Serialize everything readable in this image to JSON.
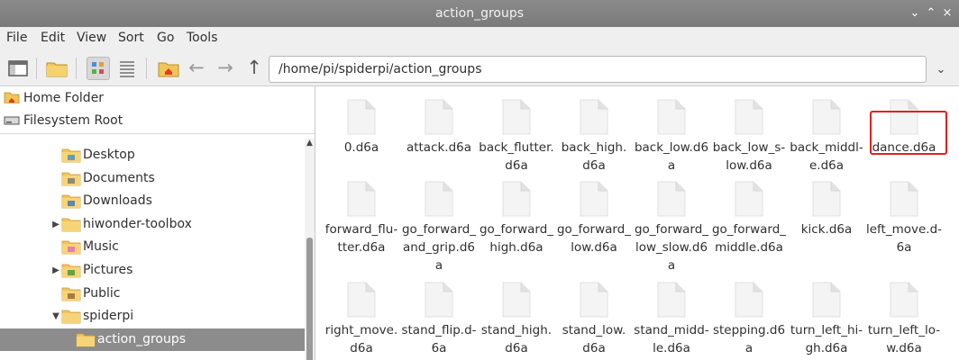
{
  "window": {
    "title": "action_groups",
    "minimize": "⌄",
    "maximize": "⌃",
    "close": "×"
  },
  "menu": [
    "File",
    "Edit",
    "View",
    "Sort",
    "Go",
    "Tools"
  ],
  "toolbar": {
    "path": "/home/pi/spiderpi/action_groups",
    "back": "←",
    "forward": "→",
    "up": "↑",
    "path_dropdown": "⌄"
  },
  "places": [
    {
      "label": "Home Folder",
      "icon": "home-folder-icon"
    },
    {
      "label": "Filesystem Root",
      "icon": "drive-icon"
    }
  ],
  "tree": [
    {
      "label": "Desktop",
      "icon": "desktop-folder-icon",
      "indent": 2,
      "expander": ""
    },
    {
      "label": "Documents",
      "icon": "documents-folder-icon",
      "indent": 2,
      "expander": ""
    },
    {
      "label": "Downloads",
      "icon": "downloads-folder-icon",
      "indent": 2,
      "expander": ""
    },
    {
      "label": "hiwonder-toolbox",
      "icon": "folder-icon",
      "indent": 2,
      "expander": "▶"
    },
    {
      "label": "Music",
      "icon": "music-folder-icon",
      "indent": 2,
      "expander": ""
    },
    {
      "label": "Pictures",
      "icon": "pictures-folder-icon",
      "indent": 2,
      "expander": "▶"
    },
    {
      "label": "Public",
      "icon": "public-folder-icon",
      "indent": 2,
      "expander": ""
    },
    {
      "label": "spiderpi",
      "icon": "folder-icon",
      "indent": 2,
      "expander": "▼"
    },
    {
      "label": "action_groups",
      "icon": "folder-icon",
      "indent": 3,
      "expander": "",
      "selected": true
    }
  ],
  "files": [
    [
      "0.d6a",
      "attack.d6a",
      "back_flutter.d6a",
      "back_high.d6a",
      "back_low.d6a",
      "back_low_s-low.d6a",
      "back_middle.d6a",
      "dance.d6a"
    ],
    [
      "forward_flu-tter.d6a",
      "go_forward_and_grip.d6a",
      "go_forward_high.d6a",
      "go_forward_low.d6a",
      "go_forward_low_slow.d6a",
      "go_forward_middle.d6a",
      "kick.d6a",
      "left_move.d-6a"
    ],
    [
      "right_move.d6a",
      "stand_flip.d-6a",
      "stand_high.d6a",
      "stand_low.d6a",
      "stand_midd-le.d6a",
      "stepping.d6a",
      "turn_left_hi-gh.d6a",
      "turn_left_lo-w.d6a"
    ]
  ],
  "file_label_lines": [
    [
      [
        "0.d6a"
      ],
      [
        "attack.d6a"
      ],
      [
        "back_flutter.",
        "d6a"
      ],
      [
        "back_high.",
        "d6a"
      ],
      [
        "back_low.d6",
        "a"
      ],
      [
        "back_low_s-",
        "low.d6a"
      ],
      [
        "back_middl-",
        "e.d6a"
      ],
      [
        "dance.d6a"
      ]
    ],
    [
      [
        "forward_flu-",
        "tter.d6a"
      ],
      [
        "go_forward_",
        "and_grip.d6",
        "a"
      ],
      [
        "go_forward_",
        "high.d6a"
      ],
      [
        "go_forward_",
        "low.d6a"
      ],
      [
        "go_forward_",
        "low_slow.d6",
        "a"
      ],
      [
        "go_forward_",
        "middle.d6a"
      ],
      [
        "kick.d6a"
      ],
      [
        "left_move.d-",
        "6a"
      ]
    ],
    [
      [
        "right_move.",
        "d6a"
      ],
      [
        "stand_flip.d-",
        "6a"
      ],
      [
        "stand_high.",
        "d6a"
      ],
      [
        "stand_low.",
        "d6a"
      ],
      [
        "stand_midd-",
        "le.d6a"
      ],
      [
        "stepping.d6",
        "a"
      ],
      [
        "turn_left_hi-",
        "gh.d6a"
      ],
      [
        "turn_left_lo-",
        "w.d6a"
      ]
    ]
  ],
  "highlighted_file": "dance.d6a",
  "colors": {
    "highlight": "#e02020",
    "selection": "#8c8c8c",
    "folder": "#f3c45a"
  }
}
